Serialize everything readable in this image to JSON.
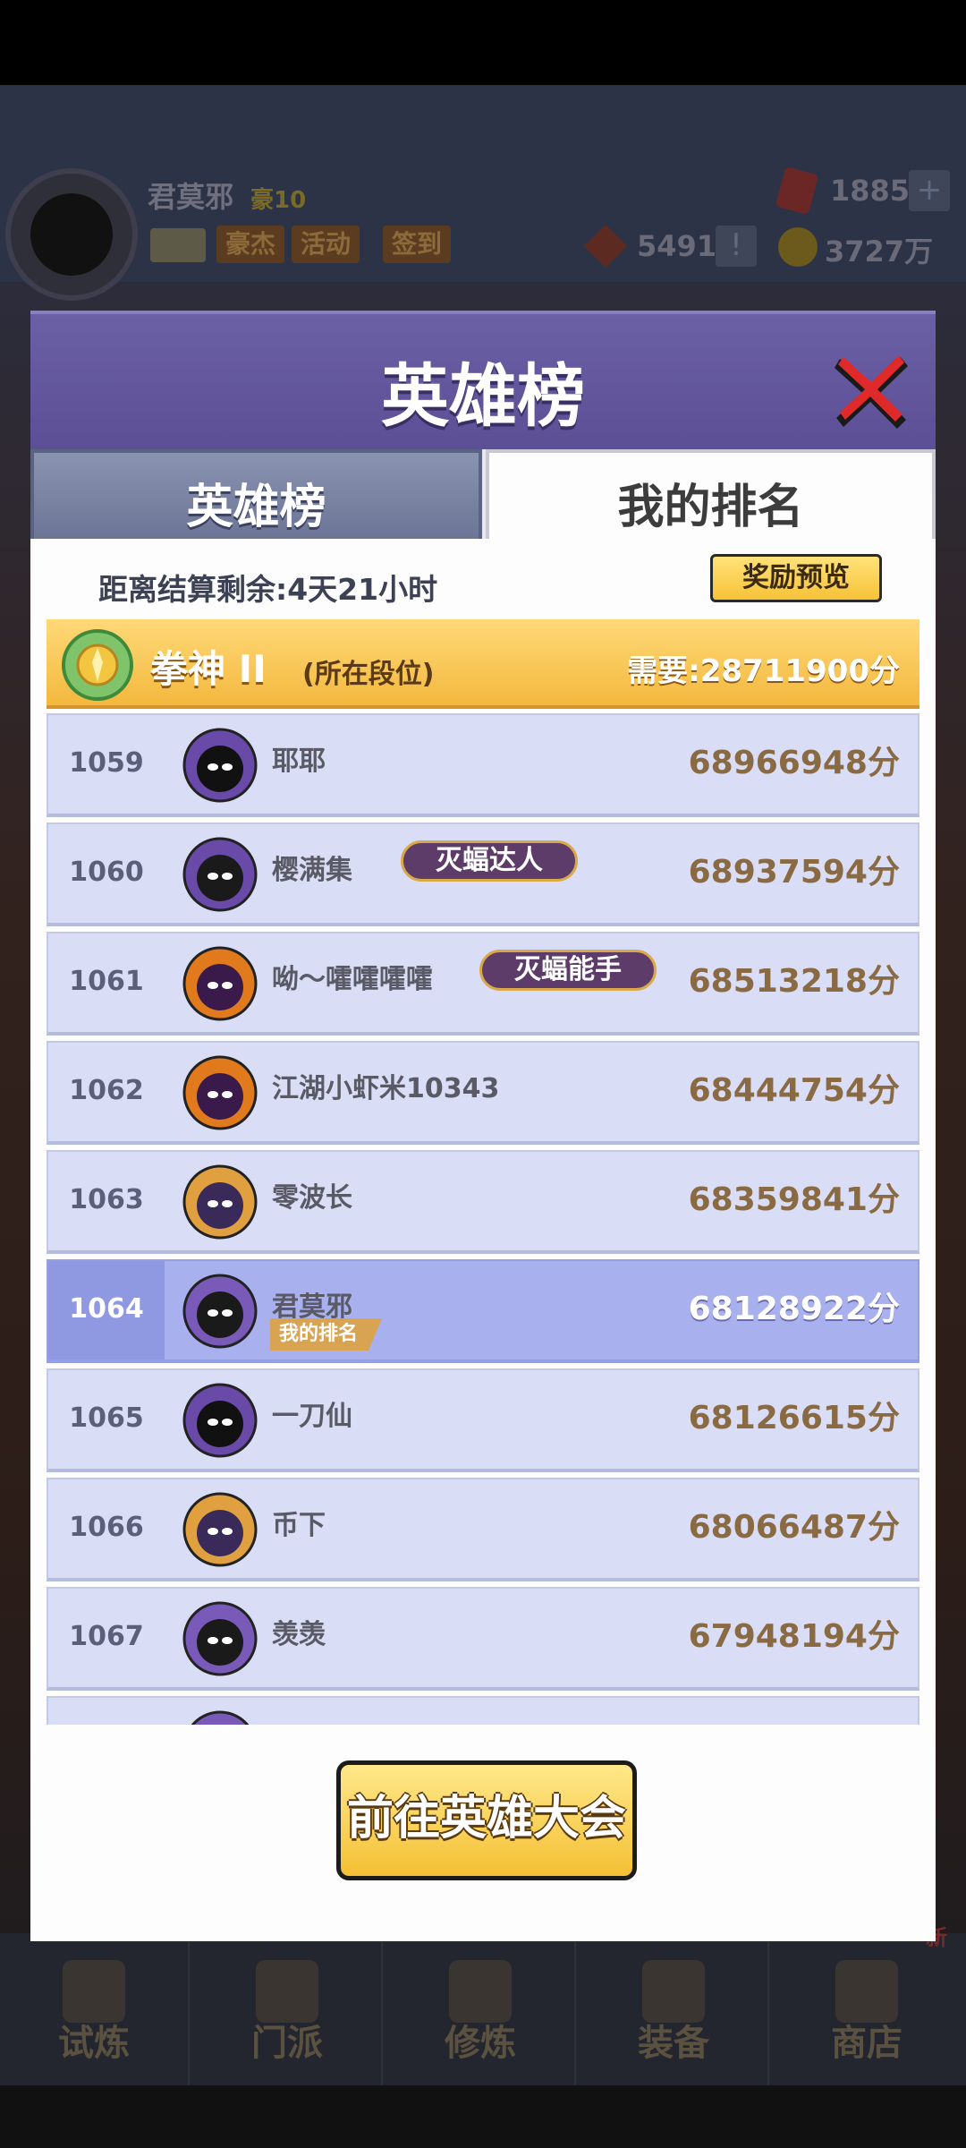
{
  "hud": {
    "player_name": "君莫邪",
    "vip": "豪10",
    "buttons": [
      "豪杰",
      "活动",
      "签到"
    ],
    "gems": "1885",
    "tokens": "5491",
    "gold": "3727万"
  },
  "modal": {
    "title": "英雄榜",
    "tabs": [
      {
        "label": "英雄榜",
        "active": false
      },
      {
        "label": "我的排名",
        "active": true
      }
    ],
    "countdown": "距离结算剩余:4天21小时",
    "reward_preview": "奖励预览",
    "tier": {
      "name": "拳神 II",
      "note": "(所在段位)",
      "requirement": "需要:28711900分"
    },
    "rows": [
      {
        "rank": "1059",
        "name": "耶耶",
        "score": "68966948分",
        "badge": "",
        "avatar": "shadow-ninja-avatar",
        "me": false
      },
      {
        "rank": "1060",
        "name": "樱满集",
        "score": "68937594分",
        "badge": "灭蝠达人",
        "avatar": "hooded-ninja-avatar",
        "me": false
      },
      {
        "rank": "1061",
        "name": "呦～嚯嚯嚯嚯",
        "score": "68513218分",
        "badge": "灭蝠能手",
        "avatar": "pumpkin-bat-avatar",
        "me": false
      },
      {
        "rank": "1062",
        "name": "江湖小虾米10343",
        "score": "68444754分",
        "badge": "",
        "avatar": "pumpkin-bat-avatar",
        "me": false
      },
      {
        "rank": "1063",
        "name": "零波长",
        "score": "68359841分",
        "badge": "",
        "avatar": "witch-bat-avatar",
        "me": false
      },
      {
        "rank": "1064",
        "name": "君莫邪",
        "score": "68128922分",
        "badge": "",
        "avatar": "ninja-master-avatar",
        "me": true,
        "tag": "我的排名"
      },
      {
        "rank": "1065",
        "name": "一刀仙",
        "score": "68126615分",
        "badge": "",
        "avatar": "shadow-ninja-avatar",
        "me": false
      },
      {
        "rank": "1066",
        "name": "币下",
        "score": "68066487分",
        "badge": "",
        "avatar": "witch-bat-avatar",
        "me": false
      },
      {
        "rank": "1067",
        "name": "羡羡",
        "score": "67948194分",
        "badge": "",
        "avatar": "ninja-master-avatar",
        "me": false
      }
    ],
    "goto_button": "前往英雄大会"
  },
  "bottom_nav": [
    "试炼",
    "门派",
    "修炼",
    "装备",
    "商店"
  ],
  "bottom_nav_new": "新",
  "colors": {
    "header_purple": "#5c4f95",
    "row_bg": "#d9ddf5",
    "row_me_bg": "#a8b0ee",
    "score_brown": "#8a6a42",
    "gold_button": "#f7c238"
  }
}
